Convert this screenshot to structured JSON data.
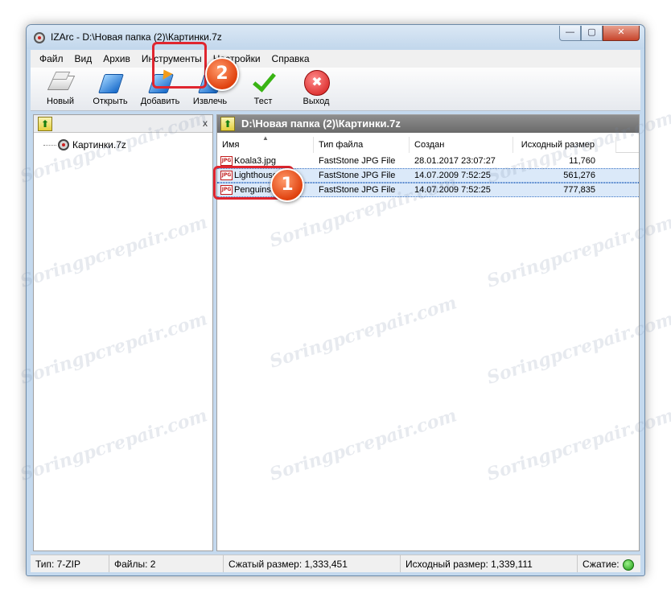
{
  "window": {
    "title": "IZArc - D:\\Новая папка (2)\\Картинки.7z",
    "buttons": {
      "minimize": "—",
      "maximize": "▢",
      "close": "✕"
    }
  },
  "menu": [
    "Файл",
    "Вид",
    "Архив",
    "Инструменты",
    "Настройки",
    "Справка"
  ],
  "toolbar": {
    "new_label": "Новый",
    "open_label": "Открыть",
    "add_label": "Добавить",
    "extract_label": "Извлечь",
    "test_label": "Тест",
    "exit_label": "Выход"
  },
  "left_pane": {
    "up_icon": "folder-up-icon",
    "close_label": "x",
    "tree_item": "Картинки.7z"
  },
  "right_pane": {
    "path": "D:\\Новая папка (2)\\Картинки.7z",
    "columns": {
      "name": "Имя",
      "type": "Тип файла",
      "created": "Создан",
      "size": "Исходный размер"
    },
    "rows": [
      {
        "name": "Koala3.jpg",
        "type": "FastStone JPG File",
        "created": "28.01.2017 23:07:27",
        "size": "11,760",
        "selected": false
      },
      {
        "name": "Lighthouse.jpg",
        "type": "FastStone JPG File",
        "created": "14.07.2009 7:52:25",
        "size": "561,276",
        "selected": true
      },
      {
        "name": "Penguins.jpg",
        "type": "FastStone JPG File",
        "created": "14.07.2009 7:52:25",
        "size": "777,835",
        "selected": true
      }
    ]
  },
  "annotations": {
    "badge1": "1",
    "badge2": "2",
    "highlight_color": "#e0262f"
  },
  "status": {
    "type": "Тип: 7-ZIP",
    "files": "Файлы: 2",
    "compressed": "Сжатый размер: 1,333,451",
    "original": "Исходный размер: 1,339,111",
    "compression": "Сжатие:"
  },
  "watermark": "Soringpcrepair.com"
}
